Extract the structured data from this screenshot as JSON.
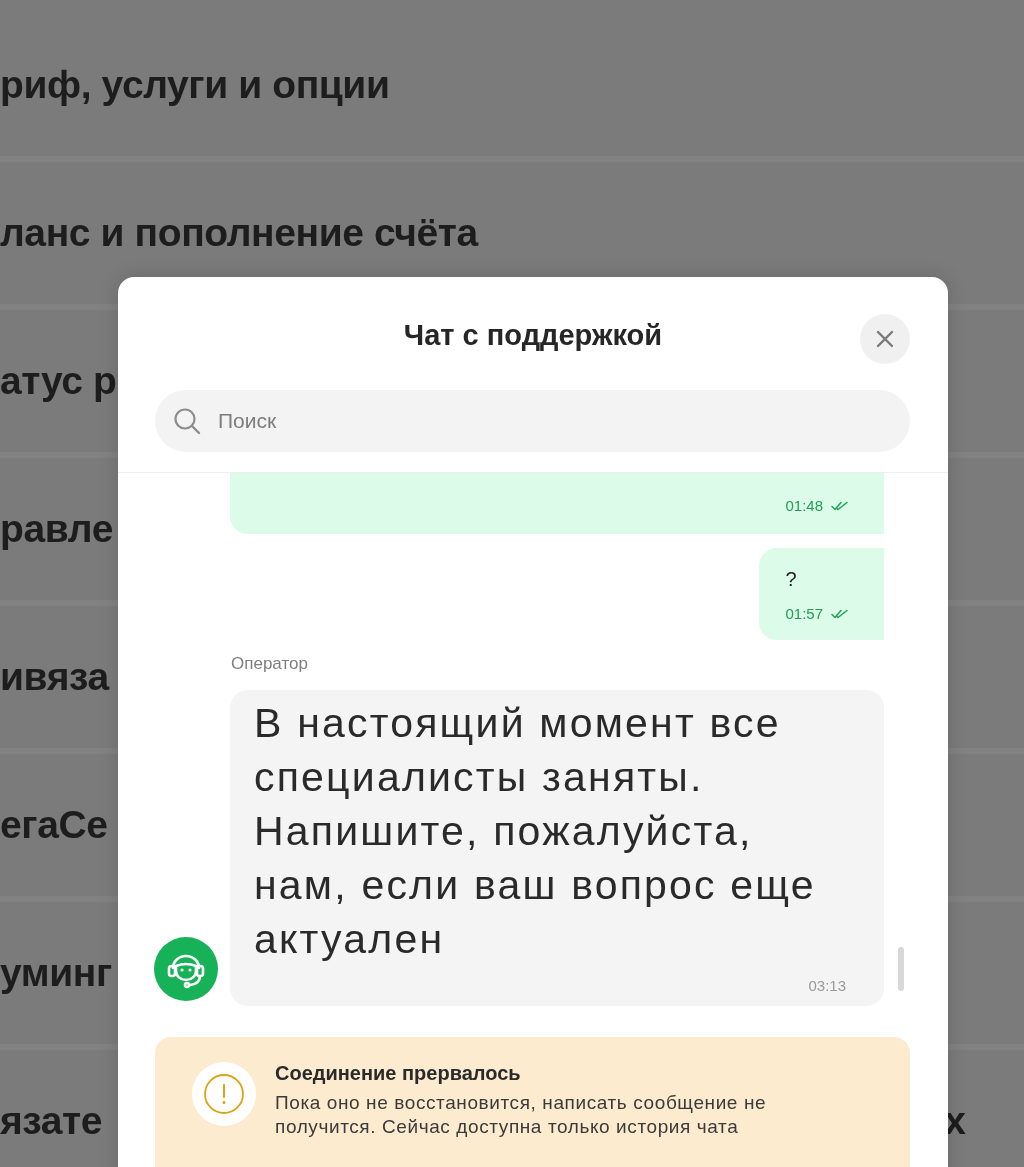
{
  "background_menu": {
    "items": [
      {
        "label": "риф, услуги и опции"
      },
      {
        "label": "ланс и пополнение счёта"
      },
      {
        "label": "атус р"
      },
      {
        "label": "равле"
      },
      {
        "label": "ивяза"
      },
      {
        "label": "егаСе"
      },
      {
        "label": "уминг"
      },
      {
        "label": "язате",
        "trailing_text": "х"
      }
    ]
  },
  "chat": {
    "title": "Чат с поддержкой",
    "search": {
      "placeholder": "Поиск"
    },
    "messages": [
      {
        "kind": "outgoing",
        "time": "01:48",
        "read": true
      },
      {
        "kind": "outgoing",
        "text": "?",
        "time": "01:57",
        "read": true
      },
      {
        "kind": "incoming",
        "sender": "Оператор",
        "text": "В настоящий момент все специалисты заняты. Напишите, пожалуйста, нам, если ваш вопрос еще актуален",
        "time": "03:13"
      }
    ],
    "notice": {
      "title": "Соединение прервалось",
      "text": "Пока оно не восстановится, написать сообщение не получится. Сейчас доступна только история чата"
    }
  }
}
